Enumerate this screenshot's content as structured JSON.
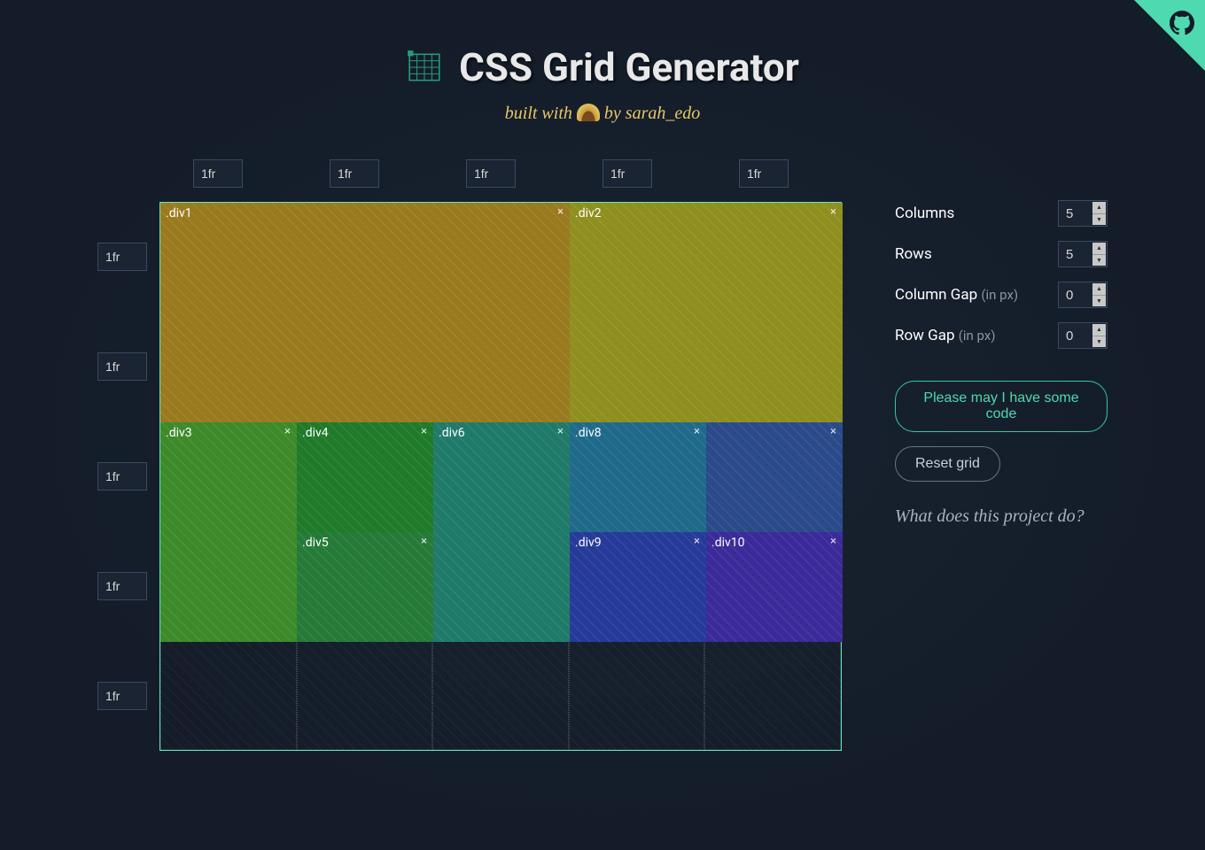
{
  "header": {
    "title": "CSS Grid Generator",
    "byline_prefix": "built with",
    "byline_by": "by",
    "byline_author": "sarah_edo"
  },
  "grid": {
    "columns": 5,
    "rows": 5,
    "col_units": [
      "1fr",
      "1fr",
      "1fr",
      "1fr",
      "1fr"
    ],
    "row_units": [
      "1fr",
      "1fr",
      "1fr",
      "1fr",
      "1fr"
    ],
    "divs": [
      {
        "label": ".div1",
        "col_start": 1,
        "col_end": 4,
        "row_start": 1,
        "row_end": 3,
        "color": "#9a7a1f"
      },
      {
        "label": ".div2",
        "col_start": 4,
        "col_end": 6,
        "row_start": 1,
        "row_end": 3,
        "color": "#8f8f1f"
      },
      {
        "label": ".div3",
        "col_start": 1,
        "col_end": 2,
        "row_start": 3,
        "row_end": 5,
        "color": "#3d8a2a"
      },
      {
        "label": ".div4",
        "col_start": 2,
        "col_end": 3,
        "row_start": 3,
        "row_end": 4,
        "color": "#1f7a2a"
      },
      {
        "label": ".div5",
        "col_start": 2,
        "col_end": 3,
        "row_start": 4,
        "row_end": 5,
        "color": "#267a38"
      },
      {
        "label": ".div6",
        "col_start": 3,
        "col_end": 4,
        "row_start": 3,
        "row_end": 5,
        "color": "#1f7a6a"
      },
      {
        "label": ".div8",
        "col_start": 4,
        "col_end": 5,
        "row_start": 3,
        "row_end": 4,
        "color": "#1f6a8a"
      },
      {
        "label": ".div9",
        "col_start": 4,
        "col_end": 5,
        "row_start": 4,
        "row_end": 5,
        "color": "#263a9a"
      },
      {
        "label": ".div10",
        "col_start": 5,
        "col_end": 6,
        "row_start": 4,
        "row_end": 5,
        "color": "#3a2a9a"
      },
      {
        "label": "",
        "col_start": 5,
        "col_end": 6,
        "row_start": 3,
        "row_end": 4,
        "color": "#2a4a8a"
      }
    ]
  },
  "sidebar": {
    "fields": {
      "columns": {
        "label": "Columns",
        "value": "5"
      },
      "rows": {
        "label": "Rows",
        "value": "5"
      },
      "col_gap": {
        "label": "Column Gap",
        "hint": "(in px)",
        "value": "0"
      },
      "row_gap": {
        "label": "Row Gap",
        "hint": "(in px)",
        "value": "0"
      }
    },
    "code_button": "Please may I have some code",
    "reset_button": "Reset grid",
    "explain_link": "What does this project do?"
  }
}
